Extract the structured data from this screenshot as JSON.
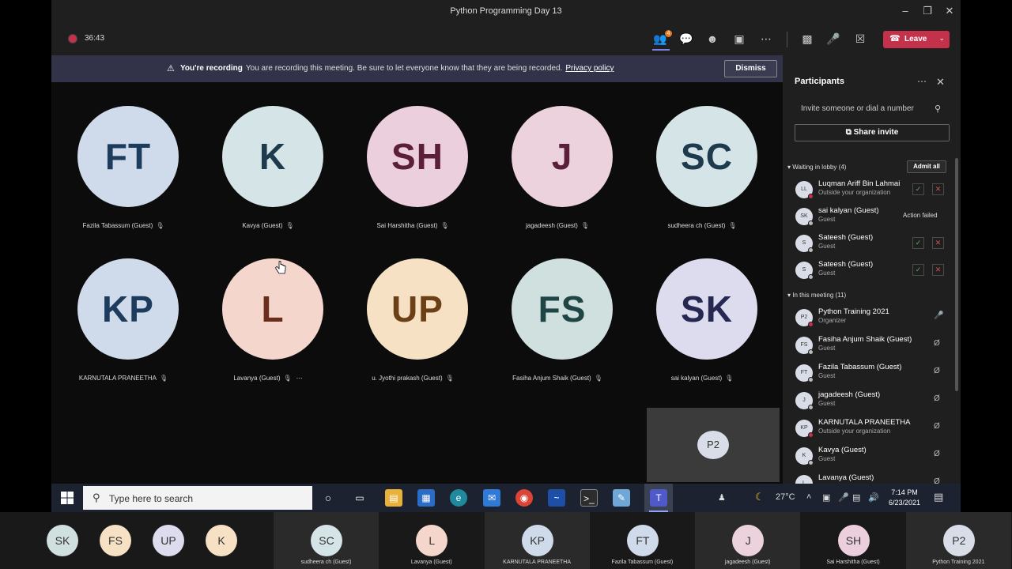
{
  "window": {
    "title": "Python Programming Day 13",
    "minimize_icon": "minimize-icon",
    "maximize_icon": "restore-icon",
    "close_icon": "close-icon"
  },
  "meeting": {
    "timer": "36:43",
    "leave_label": "Leave",
    "people_badge": "4",
    "colors": {
      "leave": "#c4314b",
      "recording": "#c4314b",
      "accent": "#7b83eb"
    }
  },
  "banner": {
    "bold": "You're recording",
    "text": "You are recording this meeting. Be sure to let everyone know that they are being recorded.",
    "link": "Privacy policy",
    "dismiss": "Dismiss"
  },
  "tiles": [
    {
      "initials": "FT",
      "name": "Fazila Tabassum (Guest)",
      "bg": "#cfdaea",
      "fg": "#1d3b5c"
    },
    {
      "initials": "K",
      "name": "Kavya (Guest)",
      "bg": "#d5e4e6",
      "fg": "#1d3b4c"
    },
    {
      "initials": "SH",
      "name": "Sai Harshitha (Guest)",
      "bg": "#ebcfdc",
      "fg": "#5b1f3a"
    },
    {
      "initials": "J",
      "name": "jagadeesh (Guest)",
      "bg": "#ecd2dd",
      "fg": "#5b1f3a"
    },
    {
      "initials": "SC",
      "name": "sudheera ch (Guest)",
      "bg": "#d5e4e6",
      "fg": "#1d3b4c"
    },
    {
      "initials": "KP",
      "name": "KARNUTALA PRANEETHA",
      "bg": "#cfdaea",
      "fg": "#1d3b5c"
    },
    {
      "initials": "L",
      "name": "Lavanya (Guest)",
      "bg": "#f5d6cc",
      "fg": "#6b2c1c"
    },
    {
      "initials": "UP",
      "name": "u. Jyothi prakash (Guest)",
      "bg": "#f7e1c4",
      "fg": "#6b4017"
    },
    {
      "initials": "FS",
      "name": "Fasiha Anjum Shaik (Guest)",
      "bg": "#cfe0df",
      "fg": "#1f4544"
    },
    {
      "initials": "SK",
      "name": "sai kalyan (Guest)",
      "bg": "#dcdcee",
      "fg": "#262852"
    }
  ],
  "self_view": {
    "initials": "P2"
  },
  "panel": {
    "title": "Participants",
    "invite_placeholder": "Invite someone or dial a number",
    "share_invite": "Share invite",
    "lobby_header": "Waiting in lobby (4)",
    "admit_all": "Admit all",
    "meeting_header": "In this meeting (11)",
    "lobby": [
      {
        "initials": "LL",
        "name": "Luqman Ariff Bin Lahmai",
        "sub": "Outside your organization",
        "status": ""
      },
      {
        "initials": "SK",
        "name": "sai kalyan (Guest)",
        "sub": "Guest",
        "status": "Action failed"
      },
      {
        "initials": "S",
        "name": "Sateesh (Guest)",
        "sub": "Guest",
        "status": ""
      },
      {
        "initials": "S",
        "name": "Sateesh (Guest)",
        "sub": "Guest",
        "status": ""
      }
    ],
    "members": [
      {
        "initials": "P2",
        "name": "Python Training 2021",
        "sub": "Organizer",
        "mic": "on"
      },
      {
        "initials": "FS",
        "name": "Fasiha Anjum Shaik (Guest)",
        "sub": "Guest",
        "mic": "off"
      },
      {
        "initials": "FT",
        "name": "Fazila Tabassum (Guest)",
        "sub": "Guest",
        "mic": "off"
      },
      {
        "initials": "J",
        "name": "jagadeesh (Guest)",
        "sub": "Guest",
        "mic": "off"
      },
      {
        "initials": "KP",
        "name": "KARNUTALA PRANEETHA",
        "sub": "Outside your organization",
        "mic": "off"
      },
      {
        "initials": "K",
        "name": "Kavya (Guest)",
        "sub": "Guest",
        "mic": "off"
      },
      {
        "initials": "L",
        "name": "Lavanya (Guest)",
        "sub": "",
        "mic": "off"
      }
    ]
  },
  "taskbar": {
    "search_placeholder": "Type here to search",
    "temperature": "27°C",
    "time": "7:14 PM",
    "date": "6/23/2021"
  },
  "strip": [
    {
      "initials": "SK",
      "name": "",
      "bg": "#cfe0df"
    },
    {
      "initials": "FS",
      "name": "",
      "bg": "#f7e1c4"
    },
    {
      "initials": "UP",
      "name": "",
      "bg": "#dcdcee"
    },
    {
      "initials": "K",
      "name": "",
      "bg": "#f7e1c4"
    },
    {
      "initials": "SC",
      "name": "sudheera ch (Guest)",
      "bg": "#d5e4e6"
    },
    {
      "initials": "L",
      "name": "Lavanya (Guest)",
      "bg": "#f5d6cc"
    },
    {
      "initials": "KP",
      "name": "KARNUTALA PRANEETHA",
      "bg": "#cfdaea"
    },
    {
      "initials": "FT",
      "name": "Fazila Tabassum (Guest)",
      "bg": "#cfdaea"
    },
    {
      "initials": "J",
      "name": "jagadeesh (Guest)",
      "bg": "#ecd2dd"
    },
    {
      "initials": "SH",
      "name": "Sai Harshitha (Guest)",
      "bg": "#ebcfdc"
    },
    {
      "initials": "P2",
      "name": "Python Training 2021",
      "bg": "#d9dde8"
    }
  ]
}
